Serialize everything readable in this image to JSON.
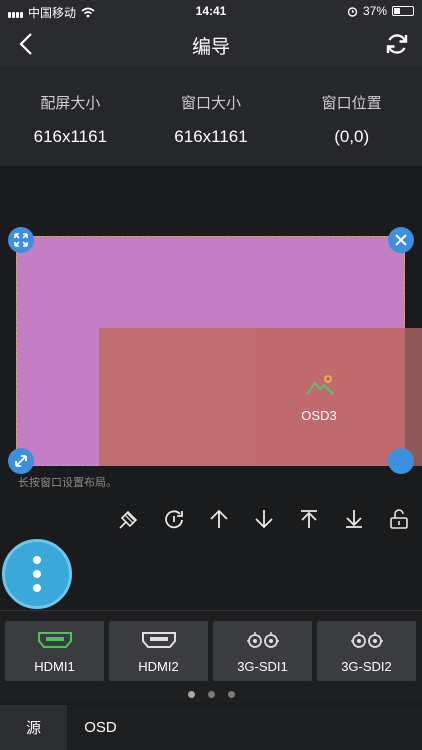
{
  "status_bar": {
    "carrier": "中国移动",
    "time": "14:41",
    "battery": "37%"
  },
  "nav": {
    "title": "编导"
  },
  "info": {
    "items": [
      {
        "label": "配屏大小",
        "value": "616x1161"
      },
      {
        "label": "窗口大小",
        "value": "616x1161"
      },
      {
        "label": "窗口位置",
        "value": "(0,0)"
      }
    ]
  },
  "canvas": {
    "window_label": "OSD3",
    "hint": "长按窗口设置布局。",
    "screen_color": "#c47fc4",
    "window_color": "#c06a6c",
    "handle_color": "#3d8fe0"
  },
  "toolbar": {
    "icons": [
      "clear-icon",
      "loop-icon",
      "move-up-icon",
      "move-down-icon",
      "move-top-icon",
      "move-bottom-icon",
      "unlock-icon"
    ]
  },
  "sources": {
    "items": [
      {
        "name": "HDMI1",
        "icon": "hdmi-icon",
        "active": true
      },
      {
        "name": "HDMI2",
        "icon": "hdmi-icon",
        "active": false
      },
      {
        "name": "3G-SDI1",
        "icon": "sdi-icon",
        "active": false
      },
      {
        "name": "3G-SDI2",
        "icon": "sdi-icon",
        "active": false
      }
    ],
    "page": 1,
    "page_count": 3
  },
  "tabs": [
    {
      "label": "源",
      "active": true
    },
    {
      "label": "OSD",
      "active": false
    }
  ],
  "colors": {
    "accent": "#3aa8d8",
    "hdmi_active": "#4cc35a"
  }
}
